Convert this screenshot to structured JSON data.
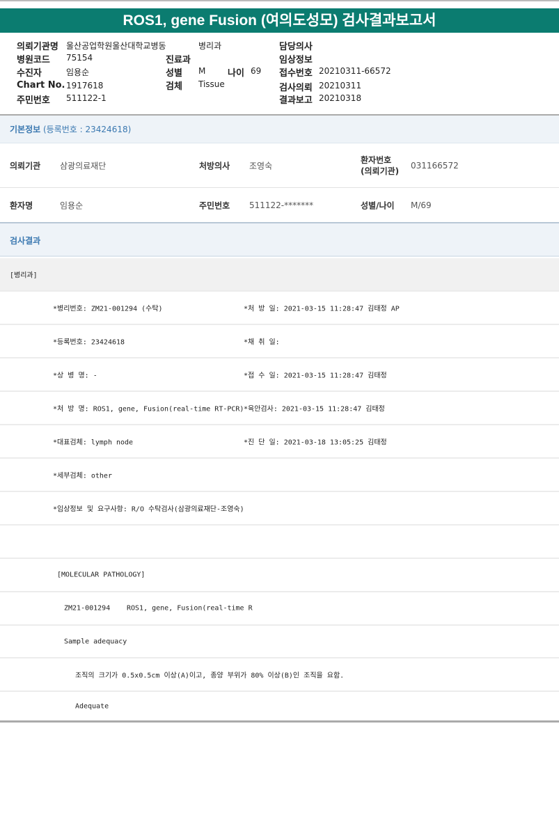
{
  "title": "ROS1, gene Fusion (여의도성모) 검사결과보고서",
  "header": {
    "req_inst_label": "의뢰기관명",
    "req_inst_value": "울산공업학원울산대학교병동",
    "ward_value": "병리과",
    "doctor_label": "담당의사",
    "hosp_code_label": "병원코드",
    "hosp_code_value": "75154",
    "dept_label": "진료과",
    "clinical_label": "임상정보",
    "patient_label": "수진자",
    "patient_value": "임용순",
    "sex_label": "성별",
    "sex_value": "M",
    "age_label": "나이",
    "age_value": "69",
    "receipt_label": "접수번호",
    "receipt_value": "20210311-66572",
    "chart_label": "Chart No.",
    "chart_value": "1917618",
    "specimen_label": "검체",
    "specimen_value": "Tissue",
    "test_req_label": "검사의뢰",
    "test_req_value": "20210311",
    "rrn_label": "주민번호",
    "rrn_value": "511122-1",
    "report_label": "결과보고",
    "report_value": "20210318"
  },
  "basic": {
    "title": "기본정보",
    "reg_no": "(등록번호 : 23424618)",
    "inst_label": "의뢰기관",
    "inst_value": "삼광의료재단",
    "presc_label": "처방의사",
    "presc_value": "조영숙",
    "pid_label_1": "환자번호",
    "pid_label_2": "(의뢰기관)",
    "pid_value": "031166572",
    "name_label": "환자명",
    "name_value": "임용순",
    "rrn_label": "주민번호",
    "rrn_value": "511122-*******",
    "sexage_label": "성별/나이",
    "sexage_value": "M/69"
  },
  "results": {
    "title": "검사결과",
    "dept": "[병리과]",
    "rows": [
      {
        "left": "*병리번호: ZM21-001294 (수탁)",
        "right": "*처 방 일: 2021-03-15 11:28:47  김태정 AP"
      },
      {
        "left": "*등록번호: 23424618",
        "right": "*채 취 일:"
      },
      {
        "left": "*상 병 명: -",
        "right": "*접 수 일: 2021-03-15 11:28:47  김태정"
      },
      {
        "left": "*처 방 명: ROS1, gene, Fusion(real-time RT-PCR)",
        "right": "*육안검사: 2021-03-15 11:28:47  김태정"
      },
      {
        "left": "*대표검체: lymph node",
        "right": "*진 단 일: 2021-03-18 13:05:25  김태정"
      },
      {
        "left": "*세부검체: other",
        "right": ""
      },
      {
        "left": "*임상정보 및 요구사항: R/O 수탁검사(삼광의료재단-조영숙)",
        "right": ""
      }
    ],
    "mol_title": "[MOLECULAR PATHOLOGY]",
    "mol_id": "ZM21-001294",
    "mol_test": "ROS1, gene, Fusion(real-time R",
    "sample_adequacy": "Sample adequacy",
    "criteria": "조직의 크기가 0.5x0.5cm 이상(A)이고, 종양 부위가 80% 이상(B)인 조직을 요함.",
    "adequacy_value": "Adequate"
  }
}
